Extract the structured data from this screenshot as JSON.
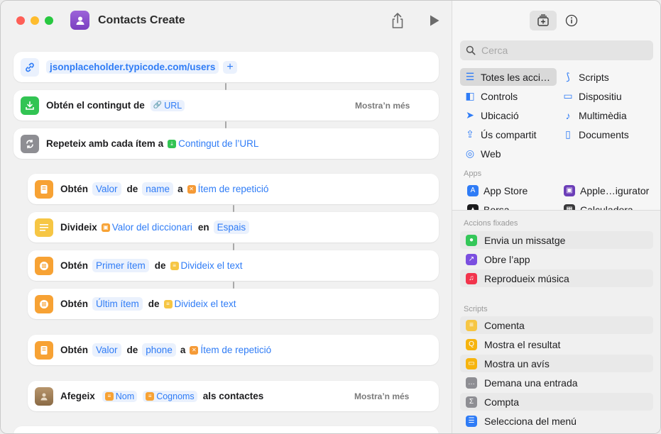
{
  "window": {
    "title": "Contacts Create"
  },
  "actions": {
    "url_card": {
      "url": "jsonplaceholder.typicode.com/users",
      "add": "+"
    },
    "get_contents": {
      "label": "Obtén el contingut de",
      "token": "URL",
      "more": "Mostra’n més"
    },
    "repeat": {
      "label": "Repeteix amb cada ítem a",
      "token": "Contingut de l’URL"
    },
    "get_value_name": {
      "verb": "Obtén",
      "t1": "Valor",
      "w1": "de",
      "t2": "name",
      "w2": "a",
      "t3": "Ítem de repetició"
    },
    "split": {
      "verb": "Divideix",
      "t1": "Valor del diccionari",
      "w1": "en",
      "t2": "Espais"
    },
    "first_item": {
      "verb": "Obtén",
      "t1": "Primer ítem",
      "w1": "de",
      "t2": "Divideix el text"
    },
    "last_item": {
      "verb": "Obtén",
      "t1": "Últim ítem",
      "w1": "de",
      "t2": "Divideix el text"
    },
    "get_value_phone": {
      "verb": "Obtén",
      "t1": "Valor",
      "w1": "de",
      "t2": "phone",
      "w2": "a",
      "t3": "Ítem de repetició"
    },
    "add_contact": {
      "verb": "Afegeix",
      "t1": "Nom",
      "t2": "Cognoms",
      "w1": "als contactes",
      "more": "Mostra’n més"
    }
  },
  "sidebar": {
    "search_placeholder": "Cerca",
    "categories": [
      {
        "label": "Totes les acci…",
        "icon": "list-icon",
        "selected": true
      },
      {
        "label": "Scripts",
        "icon": "scripts-icon"
      },
      {
        "label": "Controls",
        "icon": "toggle-icon"
      },
      {
        "label": "Dispositiu",
        "icon": "display-icon"
      },
      {
        "label": "Ubicació",
        "icon": "location-icon"
      },
      {
        "label": "Multimèdia",
        "icon": "music-note-icon"
      },
      {
        "label": "Ús compartit",
        "icon": "share-icon"
      },
      {
        "label": "Documents",
        "icon": "document-icon"
      },
      {
        "label": "Web",
        "icon": "compass-icon"
      }
    ],
    "apps_label": "Apps",
    "apps": [
      {
        "label": "App Store",
        "icon": "app-store-icon"
      },
      {
        "label": "Apple…igurator",
        "icon": "configurator-icon"
      },
      {
        "label": "Borsa",
        "icon": "stocks-icon"
      },
      {
        "label": "Calculadora",
        "icon": "calculator-icon"
      }
    ],
    "pinned_label": "Accions fixades",
    "pinned": [
      {
        "label": "Envia un missatge",
        "icon": "message-icon",
        "color": "#34c759"
      },
      {
        "label": "Obre l’app",
        "icon": "open-app-icon",
        "color": "#7b4fe0"
      },
      {
        "label": "Reprodueix música",
        "icon": "music-icon",
        "color": "#f2344c"
      }
    ],
    "scripts_label": "Scripts",
    "scripts": [
      {
        "label": "Comenta",
        "icon": "comment-icon",
        "color": "#f6c644"
      },
      {
        "label": "Mostra el resultat",
        "icon": "show-result-icon",
        "color": "#f6b40e"
      },
      {
        "label": "Mostra un avís",
        "icon": "alert-icon",
        "color": "#f6b40e"
      },
      {
        "label": "Demana una entrada",
        "icon": "ask-input-icon",
        "color": "#8e8e93"
      },
      {
        "label": "Compta",
        "icon": "count-icon",
        "color": "#8e8e93"
      },
      {
        "label": "Selecciona del menú",
        "icon": "menu-icon",
        "color": "#2f7cf6"
      }
    ]
  }
}
